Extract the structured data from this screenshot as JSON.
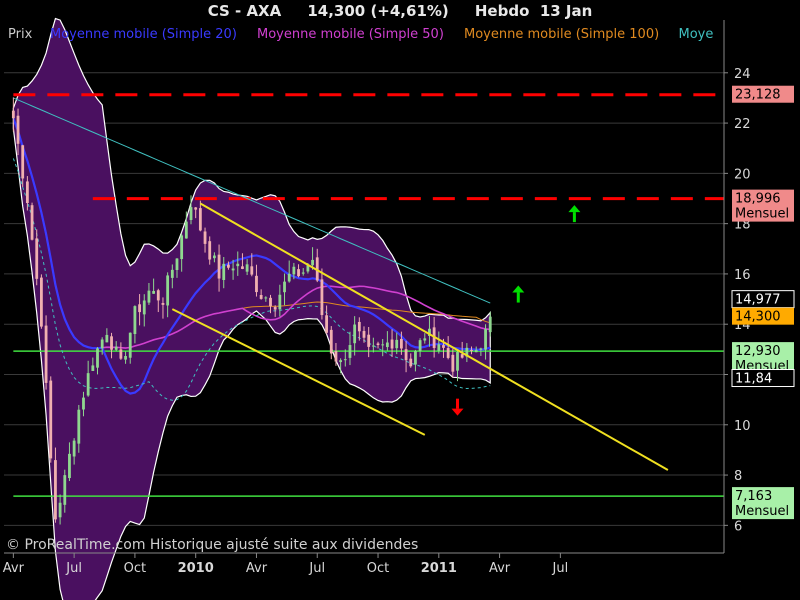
{
  "header": {
    "title": "CS - AXA     14,300 (+4,61%)     Hebdo  13 Jan"
  },
  "legend": [
    {
      "label": "Prix",
      "color": "#cccccc"
    },
    {
      "label": "Moyenne mobile (Simple 20)",
      "color": "#3a3aff"
    },
    {
      "label": "Moyenne mobile (Simple 50)",
      "color": "#d040d0"
    },
    {
      "label": "Moyenne mobile (Simple 100)",
      "color": "#e08a20"
    },
    {
      "label": "Moye",
      "color": "#40c0c0"
    }
  ],
  "footer": "© ProRealTime.com Historique ajusté suite aux dividendes",
  "colors": {
    "background": "#000000",
    "bollinger_fill": "#4a1060",
    "candle_up": "#8fd88f",
    "candle_down": "#f0b0b0",
    "resistance": "#ff0000",
    "support": "#40e040",
    "channel": "#f0e020",
    "sma20": "#3a3aff",
    "sma50": "#d040d0",
    "sma100": "#e08a20",
    "sma200": "#40c0c0"
  },
  "chart_data": {
    "type": "candlestick",
    "title": "CS - AXA",
    "ylim": [
      4.9,
      26.1
    ],
    "y_ticks": [
      6,
      8,
      10,
      12,
      14,
      16,
      18,
      20,
      22,
      24
    ],
    "x_ticks": [
      {
        "label": "Avr",
        "bold": false
      },
      {
        "label": "Jul",
        "bold": false
      },
      {
        "label": "Oct",
        "bold": false
      },
      {
        "label": "2010",
        "bold": true
      },
      {
        "label": "Avr",
        "bold": false
      },
      {
        "label": "Jul",
        "bold": false
      },
      {
        "label": "Oct",
        "bold": false
      },
      {
        "label": "2011",
        "bold": true
      },
      {
        "label": "Avr",
        "bold": false
      },
      {
        "label": "Jul",
        "bold": false
      }
    ],
    "price_tags": [
      {
        "value": 23.128,
        "label": "23,128",
        "sub": "",
        "bg": "#f08a8a"
      },
      {
        "value": 18.996,
        "label": "18,996",
        "sub": "Mensuel",
        "bg": "#f08a8a"
      },
      {
        "value": 14.977,
        "label": "14,977",
        "sub": "",
        "bg": "#000000"
      },
      {
        "value": 14.3,
        "label": "14,300",
        "sub": "",
        "bg": "#ffaa00"
      },
      {
        "value": 12.93,
        "label": "12,930",
        "sub": "Mensuel",
        "bg": "#a8f0a8"
      },
      {
        "value": 11.84,
        "label": "11,84",
        "sub": "",
        "bg": "#000000"
      },
      {
        "value": 7.163,
        "label": "7,163",
        "sub": "Mensuel",
        "bg": "#a8f0a8"
      }
    ],
    "horizontal_lines": [
      {
        "value": 23.128,
        "kind": "resistance",
        "from_week": 0
      },
      {
        "value": 18.996,
        "kind": "resistance",
        "from_week": 17
      },
      {
        "value": 12.93,
        "kind": "support",
        "from_week": 0
      },
      {
        "value": 7.163,
        "kind": "support",
        "from_week": 0
      }
    ],
    "channel_lines": [
      {
        "w1": 40,
        "v1": 18.8,
        "w2": 140,
        "v2": 8.2
      },
      {
        "w1": 34,
        "v1": 14.6,
        "w2": 88,
        "v2": 9.6
      }
    ],
    "arrows": [
      {
        "week": 120,
        "value": 18.3,
        "dir": "up",
        "color": "#00e000"
      },
      {
        "week": 108,
        "value": 15.1,
        "dir": "up",
        "color": "#00e000"
      },
      {
        "week": 95,
        "value": 10.8,
        "dir": "down",
        "color": "#ff0000"
      }
    ],
    "keypoints": [
      [
        0,
        22.2
      ],
      [
        3,
        19.0
      ],
      [
        6,
        14.2
      ],
      [
        8,
        8.6
      ],
      [
        9,
        6.3
      ],
      [
        11,
        7.8
      ],
      [
        14,
        10.6
      ],
      [
        17,
        12.6
      ],
      [
        20,
        13.8
      ],
      [
        23,
        12.3
      ],
      [
        26,
        14.4
      ],
      [
        29,
        15.3
      ],
      [
        32,
        15.0
      ],
      [
        35,
        16.8
      ],
      [
        38,
        18.9
      ],
      [
        41,
        17.3
      ],
      [
        44,
        16.0
      ],
      [
        47,
        16.4
      ],
      [
        50,
        16.2
      ],
      [
        53,
        15.2
      ],
      [
        56,
        14.9
      ],
      [
        59,
        15.9
      ],
      [
        62,
        16.1
      ],
      [
        64,
        16.6
      ],
      [
        66,
        14.4
      ],
      [
        68,
        13.0
      ],
      [
        70,
        12.4
      ],
      [
        73,
        13.8
      ],
      [
        76,
        12.8
      ],
      [
        79,
        13.1
      ],
      [
        82,
        13.5
      ],
      [
        85,
        12.4
      ],
      [
        88,
        13.6
      ],
      [
        91,
        13.3
      ],
      [
        94,
        12.4
      ],
      [
        96,
        12.7
      ],
      [
        99,
        13.0
      ],
      [
        101,
        13.6
      ],
      [
        102,
        14.3
      ]
    ]
  }
}
